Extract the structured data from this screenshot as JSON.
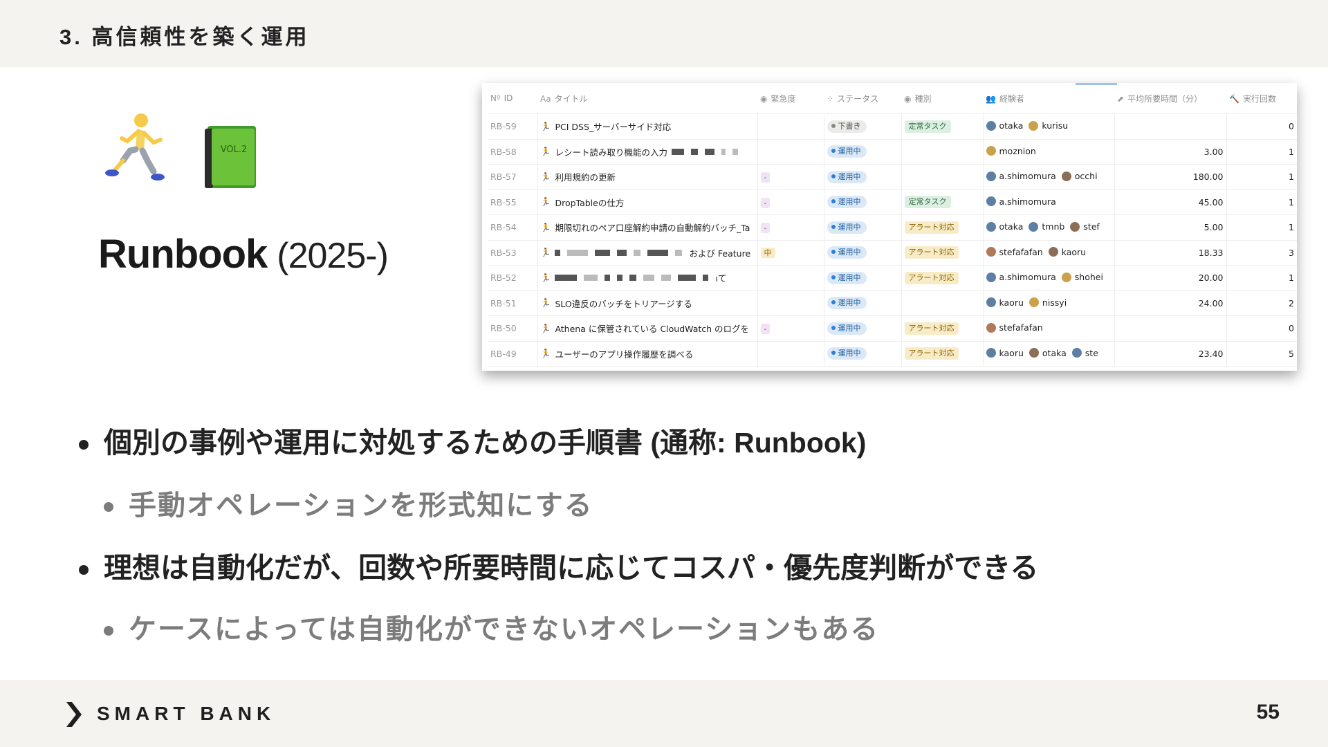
{
  "header": {
    "section_title": "3. 高信頼性を築く運用"
  },
  "hero": {
    "icons": [
      "runner-emoji",
      "green-book-emoji"
    ],
    "book_label": "VOL.2",
    "title": "Runbook",
    "year": "(2025-)"
  },
  "database": {
    "columns": [
      {
        "icon": "Nº",
        "label": "ID"
      },
      {
        "icon": "Aa",
        "label": "タイトル"
      },
      {
        "icon": "◉",
        "label": "緊急度"
      },
      {
        "icon": "⁘",
        "label": "ステータス"
      },
      {
        "icon": "◉",
        "label": "種別"
      },
      {
        "icon": "👥",
        "label": "経験者"
      },
      {
        "icon": "⬈",
        "label": "平均所要時間（分）"
      },
      {
        "icon": "🔨",
        "label": "実行回数"
      }
    ],
    "rows": [
      {
        "id": "RB-59",
        "title": "PCI DSS_サーバーサイド対応",
        "urgency": "",
        "status": "下書き",
        "type": "定常タスク",
        "people": [
          "otaka",
          "kurisu"
        ],
        "avg": "",
        "count": "0"
      },
      {
        "id": "RB-58",
        "title": "レシート読み取り機能の入力",
        "urgency": "",
        "status": "運用中",
        "type": "",
        "people": [
          "moznion"
        ],
        "avg": "3.00",
        "count": "1"
      },
      {
        "id": "RB-57",
        "title": "利用規約の更新",
        "urgency": "-",
        "status": "運用中",
        "type": "",
        "people": [
          "a.shimomura",
          "occhi"
        ],
        "avg": "180.00",
        "count": "1"
      },
      {
        "id": "RB-55",
        "title": "DropTableの仕方",
        "urgency": "-",
        "status": "運用中",
        "type": "定常タスク",
        "people": [
          "a.shimomura"
        ],
        "avg": "45.00",
        "count": "1"
      },
      {
        "id": "RB-54",
        "title": "期限切れのペア口座解約申請の自動解約バッチ_Ta",
        "urgency": "-",
        "status": "運用中",
        "type": "アラート対応",
        "people": [
          "otaka",
          "tmnb",
          "stef"
        ],
        "avg": "5.00",
        "count": "1"
      },
      {
        "id": "RB-53",
        "title": "および Feature",
        "urgency": "中",
        "status": "運用中",
        "type": "アラート対応",
        "people": [
          "stefafafan",
          "kaoru"
        ],
        "avg": "18.33",
        "count": "3"
      },
      {
        "id": "RB-52",
        "title": "ıて",
        "urgency": "",
        "status": "運用中",
        "type": "アラート対応",
        "people": [
          "a.shimomura",
          "shohei"
        ],
        "avg": "20.00",
        "count": "1"
      },
      {
        "id": "RB-51",
        "title": "SLO違反のバッチをトリアージする",
        "urgency": "",
        "status": "運用中",
        "type": "",
        "people": [
          "kaoru",
          "nissyi"
        ],
        "avg": "24.00",
        "count": "2"
      },
      {
        "id": "RB-50",
        "title": "Athena に保管されている CloudWatch のログを",
        "urgency": "-",
        "status": "運用中",
        "type": "アラート対応",
        "people": [
          "stefafafan"
        ],
        "avg": "",
        "count": "0"
      },
      {
        "id": "RB-49",
        "title": "ユーザーのアプリ操作履歴を調べる",
        "urgency": "",
        "status": "運用中",
        "type": "アラート対応",
        "people": [
          "kaoru",
          "otaka",
          "ste"
        ],
        "avg": "23.40",
        "count": "5"
      }
    ]
  },
  "bullets": [
    {
      "level": 1,
      "text": "個別の事例や運用に対処するための手順書 (通称: Runbook)"
    },
    {
      "level": 2,
      "text": "手動オペレーションを形式知にする"
    },
    {
      "level": 1,
      "text": "理想は自動化だが、回数や所要時間に応じてコスパ・優先度判断ができる"
    },
    {
      "level": 2,
      "text": "ケースによっては自動化ができないオペレーションもある"
    }
  ],
  "footer": {
    "brand": "SMART BANK",
    "page_number": "55"
  },
  "colors": {
    "band_bg": "#f4f3ef",
    "status_draft_bg": "#ebebea",
    "status_active_bg": "#dbe9f7",
    "status_active_dot": "#2f7fd6",
    "type_routine_bg": "#dcefe2",
    "type_alert_bg": "#f8ecc8",
    "urgency_dash_bg": "#efe3f4",
    "urgency_mid_bg": "#f8ecc8"
  }
}
